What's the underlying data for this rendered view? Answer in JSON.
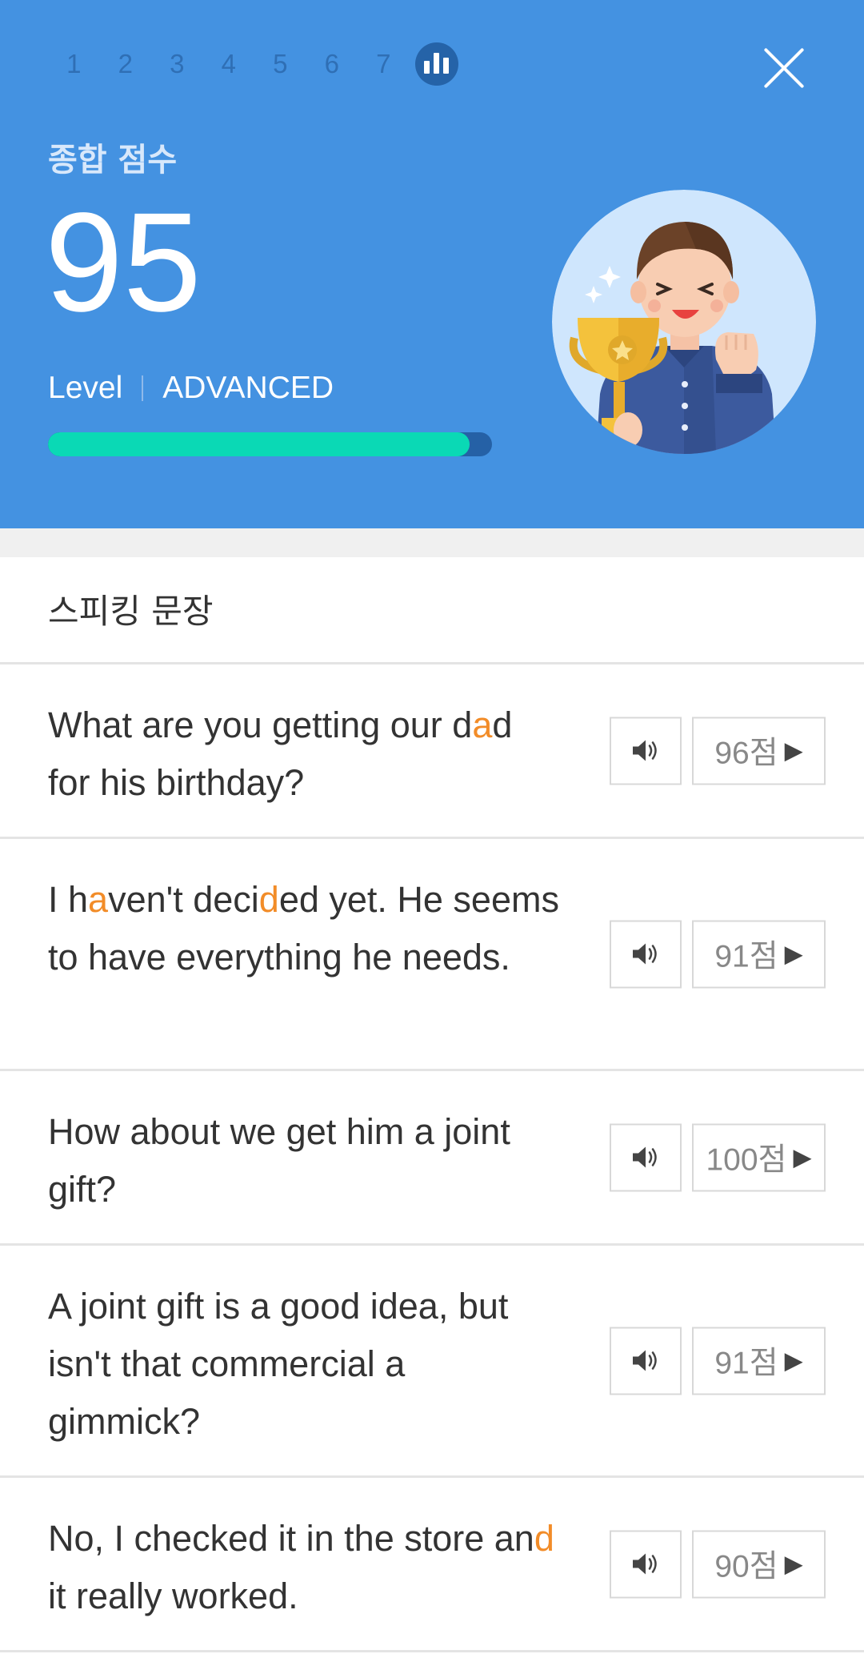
{
  "colors": {
    "header_bg": "#4492e1",
    "accent_highlight": "#f28c28",
    "progress_fill": "#0ad9b5",
    "progress_track": "#2561a6"
  },
  "header": {
    "steps": [
      "1",
      "2",
      "3",
      "4",
      "5",
      "6",
      "7"
    ],
    "active_step_icon": "bar-chart-icon",
    "close_icon": "close-icon",
    "score_label": "종합 점수",
    "score": "95",
    "level_label": "Level",
    "level_value": "ADVANCED",
    "progress_fraction": 0.95,
    "avatar_icon": "trophy-boy-illustration"
  },
  "section": {
    "title": "스피킹 문장"
  },
  "sentences": [
    {
      "text_parts": [
        {
          "t": "What are you getting our d"
        },
        {
          "t": "a",
          "hl": true
        },
        {
          "t": "d for his birthday?"
        }
      ],
      "score": "96점",
      "audio_icon": "speaker-icon",
      "play_icon": "play-icon"
    },
    {
      "text_parts": [
        {
          "t": "I h"
        },
        {
          "t": "a",
          "hl": true
        },
        {
          "t": "ven't deci"
        },
        {
          "t": "d",
          "hl": true
        },
        {
          "t": "ed yet. He seems to have everything he needs."
        }
      ],
      "score": "91점",
      "audio_icon": "speaker-icon",
      "play_icon": "play-icon"
    },
    {
      "text_parts": [
        {
          "t": "How about we get him a joint gift?"
        }
      ],
      "score": "100점",
      "audio_icon": "speaker-icon",
      "play_icon": "play-icon"
    },
    {
      "text_parts": [
        {
          "t": "A joint gift is a good idea, but isn't that commercial a gimmick?"
        }
      ],
      "score": "91점",
      "audio_icon": "speaker-icon",
      "play_icon": "play-icon"
    },
    {
      "text_parts": [
        {
          "t": "No, I checked it in the store an"
        },
        {
          "t": "d",
          "hl": true
        },
        {
          "t": " it really worked."
        }
      ],
      "score": "90점",
      "audio_icon": "speaker-icon",
      "play_icon": "play-icon"
    }
  ]
}
